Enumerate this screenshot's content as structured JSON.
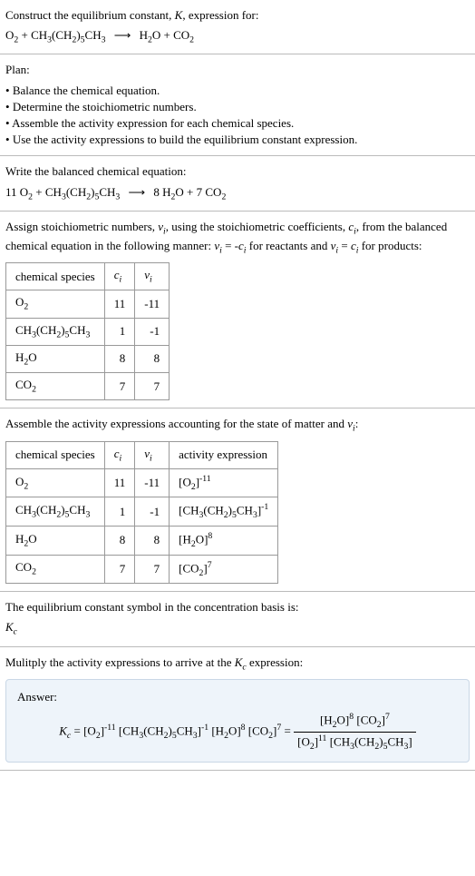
{
  "title": {
    "line1": "Construct the equilibrium constant, ",
    "K": "K",
    "line1b": ", expression for:"
  },
  "reaction_unbalanced": {
    "r1": "O",
    "r1sub": "2",
    "plus1": " + ",
    "r2a": "CH",
    "r2asub": "3",
    "r2b": "(CH",
    "r2bsub": "2",
    "r2c": ")",
    "r2csub": "5",
    "r2d": "CH",
    "r2dsub": "3",
    "arrow": "⟶",
    "p1": "H",
    "p1sub": "2",
    "p1b": "O",
    "plus2": " + ",
    "p2": "CO",
    "p2sub": "2"
  },
  "plan": {
    "heading": "Plan:",
    "items": [
      "Balance the chemical equation.",
      "Determine the stoichiometric numbers.",
      "Assemble the activity expression for each chemical species.",
      "Use the activity expressions to build the equilibrium constant expression."
    ]
  },
  "balanced": {
    "heading": "Write the balanced chemical equation:",
    "c1": "11 ",
    "r1": "O",
    "r1sub": "2",
    "plus1": " + ",
    "r2a": "CH",
    "r2asub": "3",
    "r2b": "(CH",
    "r2bsub": "2",
    "r2c": ")",
    "r2csub": "5",
    "r2d": "CH",
    "r2dsub": "3",
    "arrow": "⟶",
    "c3": "8 ",
    "p1": "H",
    "p1sub": "2",
    "p1b": "O",
    "plus2": " + ",
    "c4": "7 ",
    "p2": "CO",
    "p2sub": "2"
  },
  "stoich": {
    "text1": "Assign stoichiometric numbers, ",
    "nu": "ν",
    "sub_i": "i",
    "text2": ", using the stoichiometric coefficients, ",
    "c": "c",
    "text3": ", from the balanced chemical equation in the following manner: ",
    "eq1a": "ν",
    "eq1b": " = -",
    "eq1c": "c",
    "text4": " for reactants and ",
    "eq2a": "ν",
    "eq2b": " = ",
    "eq2c": "c",
    "text5": " for products:",
    "table": {
      "h1": "chemical species",
      "h2": "c",
      "h2sub": "i",
      "h3": "ν",
      "h3sub": "i",
      "rows": [
        {
          "sp_a": "O",
          "sp_asub": "2",
          "c": "11",
          "nu": "-11"
        },
        {
          "sp_a": "CH",
          "sp_asub": "3",
          "sp_b": "(CH",
          "sp_bsub": "2",
          "sp_c": ")",
          "sp_csub": "5",
          "sp_d": "CH",
          "sp_dsub": "3",
          "c": "1",
          "nu": "-1"
        },
        {
          "sp_a": "H",
          "sp_asub": "2",
          "sp_b": "O",
          "c": "8",
          "nu": "8"
        },
        {
          "sp_a": "CO",
          "sp_asub": "2",
          "c": "7",
          "nu": "7"
        }
      ]
    }
  },
  "activity": {
    "heading": "Assemble the activity expressions accounting for the state of matter and ",
    "nu": "ν",
    "sub_i": "i",
    "colon": ":",
    "table": {
      "h1": "chemical species",
      "h2": "c",
      "h2sub": "i",
      "h3": "ν",
      "h3sub": "i",
      "h4": "activity expression",
      "rows": [
        {
          "sp": "O2",
          "c": "11",
          "nu": "-11",
          "act_base": "[O",
          "act_sub": "2",
          "act_close": "]",
          "act_exp": "-11"
        },
        {
          "sp": "Heptane",
          "c": "1",
          "nu": "-1",
          "act_exp": "-1"
        },
        {
          "sp": "H2O",
          "c": "8",
          "nu": "8",
          "act_base": "[H",
          "act_sub": "2",
          "act_mid": "O]",
          "act_exp": "8"
        },
        {
          "sp": "CO2",
          "c": "7",
          "nu": "7",
          "act_base": "[CO",
          "act_sub": "2",
          "act_close": "]",
          "act_exp": "7"
        }
      ]
    }
  },
  "symbol": {
    "heading": "The equilibrium constant symbol in the concentration basis is:",
    "K": "K",
    "sub": "c"
  },
  "multiply": {
    "heading1": "Mulitply the activity expressions to arrive at the ",
    "K": "K",
    "sub": "c",
    "heading2": " expression:"
  },
  "answer": {
    "label": "Answer:",
    "Kc_K": "K",
    "Kc_sub": "c",
    "eq": " = ",
    "t1_base": "[O",
    "t1_sub": "2",
    "t1_close": "]",
    "t1_exp": "-11",
    "t2_exp": "-1",
    "t3_base": "[H",
    "t3_sub": "2",
    "t3_mid": "O]",
    "t3_exp": "8",
    "t4_base": "[CO",
    "t4_sub": "2",
    "t4_close": "]",
    "t4_exp": "7",
    "eq2": " = ",
    "num_t3_base": "[H",
    "num_t3_sub": "2",
    "num_t3_mid": "O]",
    "num_t3_exp": "8",
    "num_t4_base": "[CO",
    "num_t4_sub": "2",
    "num_t4_close": "]",
    "num_t4_exp": "7",
    "den_t1_base": "[O",
    "den_t1_sub": "2",
    "den_t1_close": "]",
    "den_t1_exp": "11"
  },
  "heptane": {
    "a": "CH",
    "asub": "3",
    "b": "(CH",
    "bsub": "2",
    "c": ")",
    "csub": "5",
    "d": "CH",
    "dsub": "3"
  }
}
